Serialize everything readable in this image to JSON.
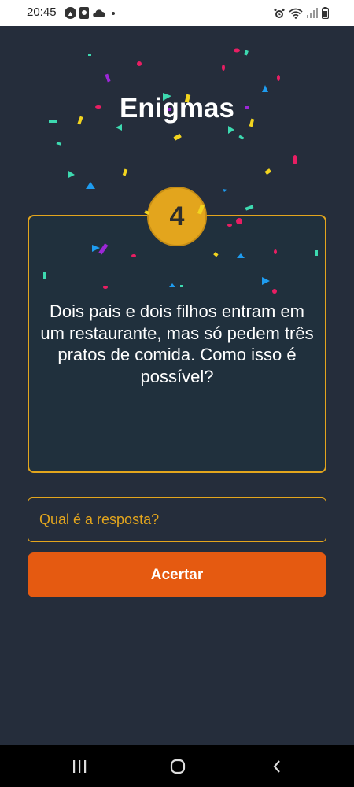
{
  "status_bar": {
    "time": "20:45",
    "left_icons": [
      "a-circle-icon",
      "calendar-icon",
      "cloud-icon",
      "dot-icon"
    ],
    "right_icons": [
      "alarm-icon",
      "wifi-icon",
      "signal-icon",
      "battery-icon"
    ]
  },
  "app": {
    "title": "Enigmas"
  },
  "riddle": {
    "number": "4",
    "text": "Dois pais e dois filhos entram em um restaurante, mas só pedem três pratos de comida. Como isso é possível?"
  },
  "answer": {
    "placeholder": "Qual é a resposta?",
    "value": ""
  },
  "submit": {
    "label": "Acertar"
  },
  "nav_bar": {
    "buttons": [
      "recents-icon",
      "home-icon",
      "back-icon"
    ]
  },
  "colors": {
    "background": "#252d3b",
    "card": "#20303d",
    "accent": "#e3a51d",
    "button": "#e55a11"
  }
}
